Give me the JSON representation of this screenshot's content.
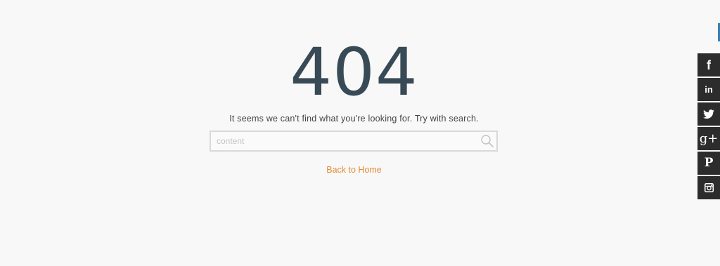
{
  "error": {
    "code": "404",
    "message": "It seems we can't find what you're looking for. Try with search."
  },
  "search": {
    "placeholder": "content",
    "value": "",
    "icon": "search-icon"
  },
  "links": {
    "back_home": "Back to Home"
  },
  "social": [
    {
      "name": "facebook",
      "glyph": "f"
    },
    {
      "name": "linkedin",
      "glyph": "in"
    },
    {
      "name": "twitter",
      "glyph": ""
    },
    {
      "name": "google-plus",
      "glyph": "g+"
    },
    {
      "name": "pinterest",
      "glyph": "P"
    },
    {
      "name": "instagram",
      "glyph": ""
    }
  ],
  "colors": {
    "background": "#f8f8f8",
    "heading": "#374a55",
    "link": "#e38b35",
    "social_bg": "#2c2c2c",
    "accent_tab": "#3a7fb0"
  }
}
